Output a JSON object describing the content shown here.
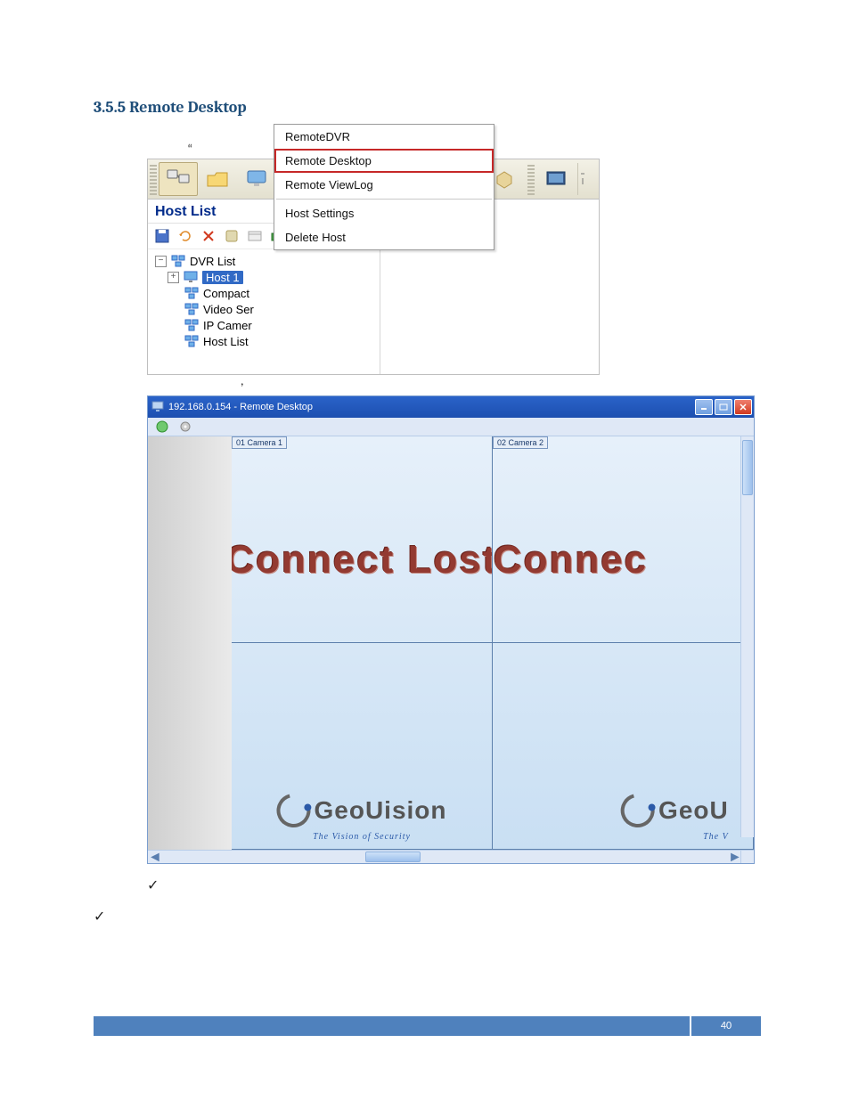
{
  "heading": "3.5.5 Remote Desktop",
  "caption1": {
    "pre_quote": "“",
    "post_quote": "”"
  },
  "panel": {
    "title": "Host List",
    "tree": {
      "root": "DVR List",
      "host1": "Host 1",
      "compact": "Compact",
      "videoser": "Video Ser",
      "ipcamer": "IP Camer",
      "hostlist": "Host List"
    }
  },
  "context_menu": {
    "remotedvr": "RemoteDVR",
    "remotedesktop": "Remote Desktop",
    "remoteviewlog": "Remote ViewLog",
    "hostsettings": "Host Settings",
    "deletehost": "Delete Host"
  },
  "below1": ",",
  "rd_window": {
    "title": "192.168.0.154 - Remote Desktop",
    "cam1": "01 Camera 1",
    "cam2": "02 Camera 2",
    "msg1": "Connect Lost",
    "msg2": "Connec",
    "brand_full": "GeoUision",
    "brand_short": "GeoU",
    "tagline_full": "The Vision of Security",
    "tagline_short": "The V"
  },
  "page_number": "40"
}
